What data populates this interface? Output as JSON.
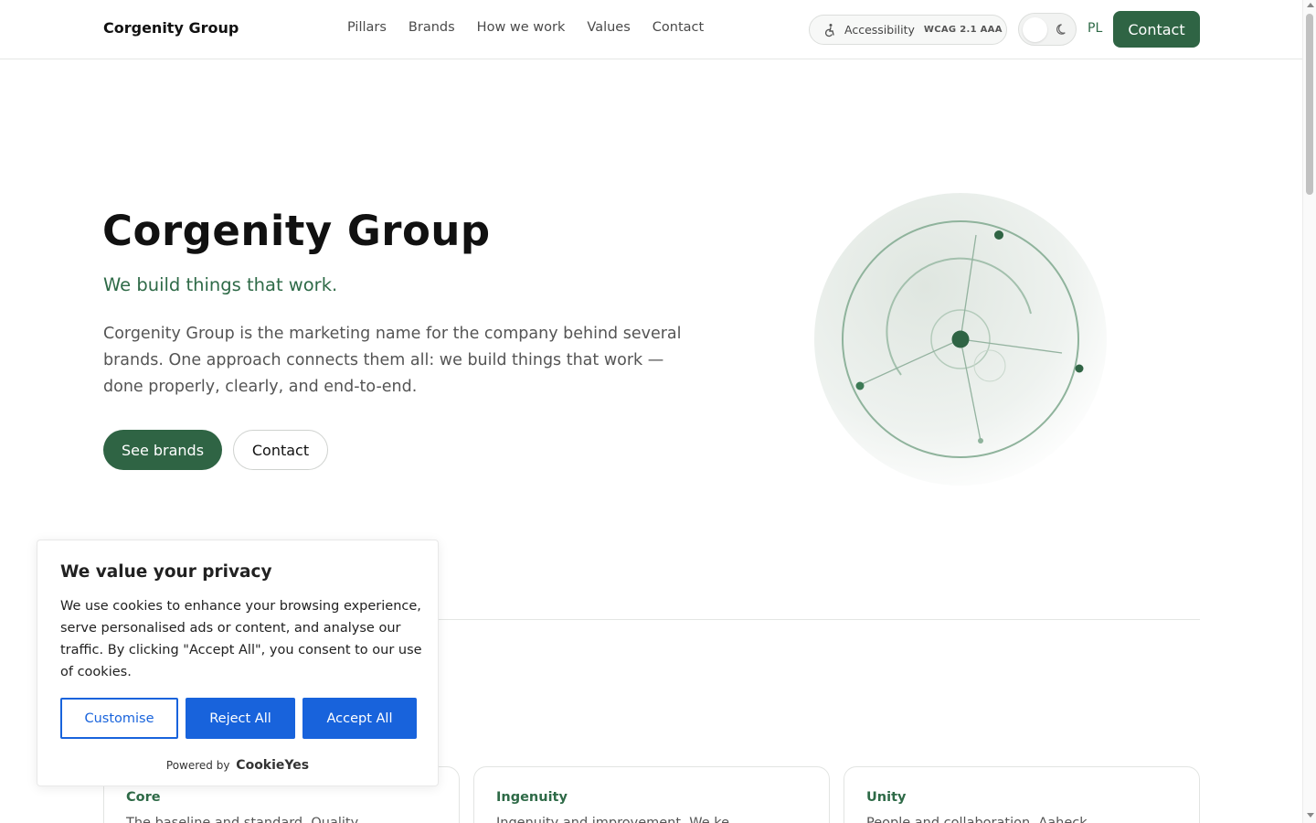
{
  "header": {
    "brand": "Corgenity Group",
    "nav": [
      "Pillars",
      "Brands",
      "How we work",
      "Values",
      "Contact"
    ],
    "accessibility_label": "Accessibility",
    "accessibility_badge": "WCAG 2.1 AAA",
    "language": "PL",
    "contact_label": "Contact"
  },
  "hero": {
    "title": "Corgenity Group",
    "tagline": "We build things that work.",
    "description": "Corgenity Group is the marketing name for the company behind several brands. One approach connects them all: we build things that work — done properly, clearly, and end-to-end.",
    "primary_button": "See brands",
    "secondary_button": "Contact"
  },
  "cards": [
    {
      "title": "Core",
      "body": "The baseline and standard. Quality"
    },
    {
      "title": "Ingenuity",
      "body": "Ingenuity and improvement. We ke"
    },
    {
      "title": "Unity",
      "body": "People and collaboration. Aaheck"
    }
  ],
  "cookie": {
    "title": "We value your privacy",
    "body": "We use cookies to enhance your browsing experience, serve personalised ads or content, and analyse our traffic. By clicking \"Accept All\", you consent to our use of cookies.",
    "customise": "Customise",
    "reject": "Reject All",
    "accept": "Accept All",
    "powered_by": "Powered by",
    "provider": "CookieYes"
  },
  "colors": {
    "accent": "#2f6444",
    "cookie_blue": "#1863dc"
  }
}
